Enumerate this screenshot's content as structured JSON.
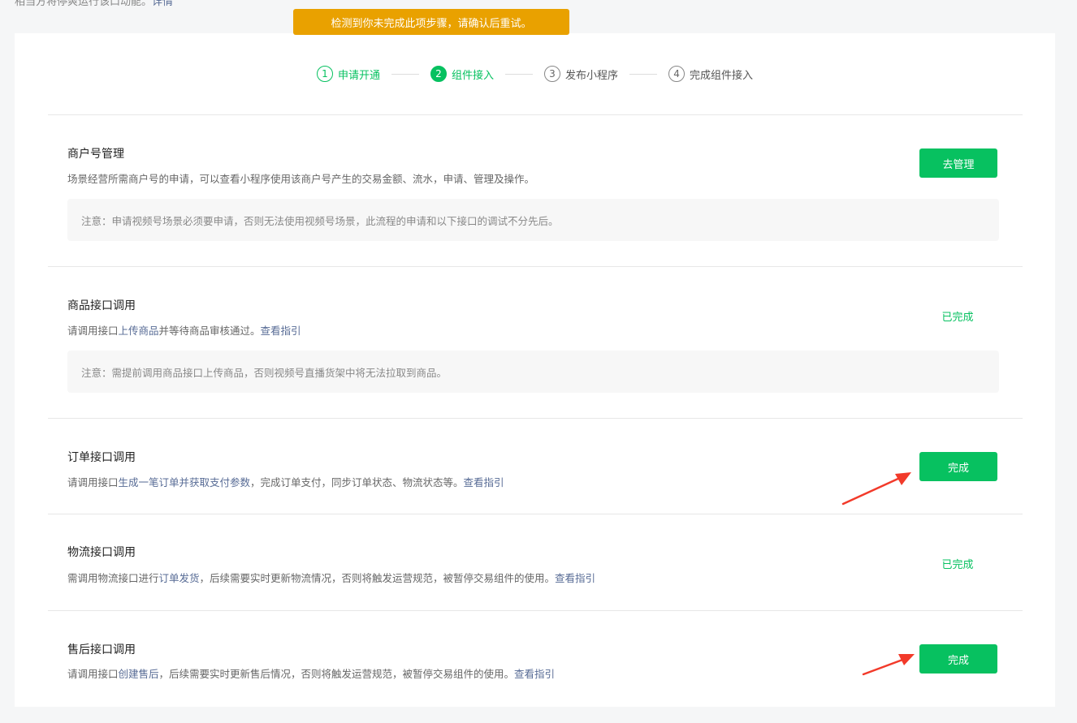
{
  "top_cut": {
    "text": "相当方将停爽运行该口动能。",
    "link": "详情"
  },
  "toast": "检测到你未完成此项步骤，请确认后重试。",
  "steps": [
    {
      "num": "1",
      "label": "申请开通"
    },
    {
      "num": "2",
      "label": "组件接入"
    },
    {
      "num": "3",
      "label": "发布小程序"
    },
    {
      "num": "4",
      "label": "完成组件接入"
    }
  ],
  "sections": [
    {
      "title": "商户号管理",
      "desc": "场景经营所需商户号的申请，可以查看小程序使用该商户号产生的交易金额、流水，申请、管理及操作。",
      "note": "注意：申请视频号场景必须要申请，否则无法使用视频号场景，此流程的申请和以下接口的调试不分先后。",
      "button": "去管理"
    },
    {
      "title": "商品接口调用",
      "desc_pre": "请调用接口",
      "desc_hl": "上传商品",
      "desc_mid": "并等待商品审核通过。",
      "link": "查看指引",
      "note": "注意：需提前调用商品接口上传商品，否则视频号直播货架中将无法拉取到商品。",
      "status": "已完成"
    },
    {
      "title": "订单接口调用",
      "desc_pre": "请调用接口",
      "desc_hl": "生成一笔订单并获取支付参数",
      "desc_mid": "，完成订单支付，同步订单状态、物流状态等。",
      "link": "查看指引",
      "button": "完成"
    },
    {
      "title": "物流接口调用",
      "desc_pre": "需调用物流接口进行",
      "desc_hl": "订单发货",
      "desc_mid": "，后续需要实时更新物流情况，否则将触发运营规范，被暂停交易组件的使用。",
      "link": "查看指引",
      "status": "已完成"
    },
    {
      "title": "售后接口调用",
      "desc_pre": "请调用接口",
      "desc_hl": "创建售后",
      "desc_mid": "，后续需要实时更新售后情况，否则将触发运营规范，被暂停交易组件的使用。",
      "link": "查看指引",
      "button": "完成"
    }
  ],
  "colors": {
    "brand": "#07c160",
    "toast": "#e9a100",
    "link": "#576b95",
    "arrow": "#f23a2a"
  }
}
